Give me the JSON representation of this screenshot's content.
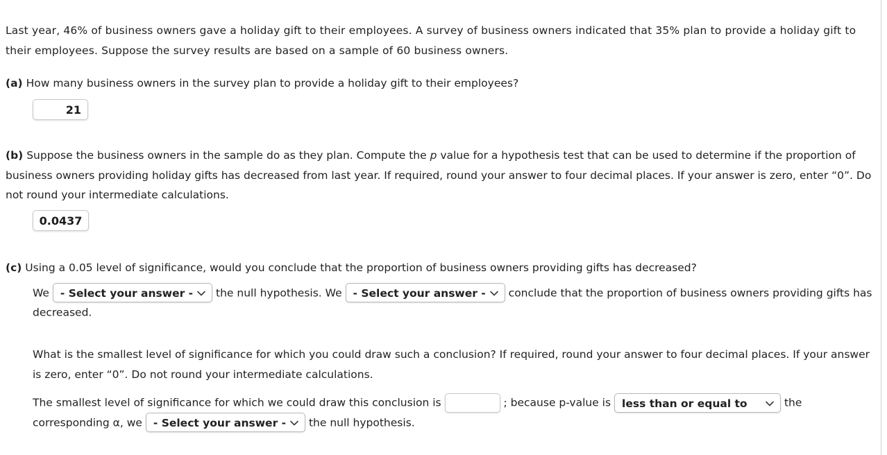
{
  "intro": {
    "text": "Last year, 46% of business owners gave a holiday gift to their employees. A survey of business owners indicated that 35% plan to provide a holiday gift to their employees. Suppose the survey results are based on a sample of 60 business owners."
  },
  "parts": {
    "a": {
      "label": "(a)",
      "question": "How many business owners in the survey plan to provide a holiday gift to their employees?",
      "answer_value": "21"
    },
    "b": {
      "label": "(b)",
      "question_1": "Suppose the business owners in the sample do as they plan. Compute the ",
      "italic_token": "p",
      "question_2": " value for a hypothesis test that can be used to determine if the proportion of business owners providing holiday gifts has decreased from last year. If required, round your answer to four decimal places. If your answer is zero, enter “0”. Do not round your intermediate calculations.",
      "answer_value": "0.0437"
    },
    "c": {
      "label": "(c)",
      "question": "Using a 0.05 level of significance, would you conclude that the proportion of business owners providing gifts has decreased?",
      "sentence_start": "We",
      "select_1": "- Select your answer -",
      "sentence_mid_1": "the null hypothesis. We",
      "select_2": "- Select your answer -",
      "sentence_mid_2": "conclude that the proportion of business owners providing gifts has decreased.",
      "followup_question": "What is the smallest level of significance for which you could draw such a conclusion? If required, round your answer to four decimal places. If your answer is zero, enter “0”. Do not round your intermediate calculations.",
      "final_start": "The smallest level of significance for which we could draw this conclusion is",
      "final_input_value": "",
      "final_mid_1": "; because p-value is",
      "select_3": "less than or equal to",
      "final_mid_2": "the corresponding α, we",
      "select_4": "- Select your answer -",
      "final_end": "the null hypothesis."
    }
  },
  "colors": {
    "text": "#231f20",
    "border": "#c9c9c9",
    "background": "#ffffff"
  },
  "icons": {
    "dropdown": "chevron-down-icon"
  }
}
